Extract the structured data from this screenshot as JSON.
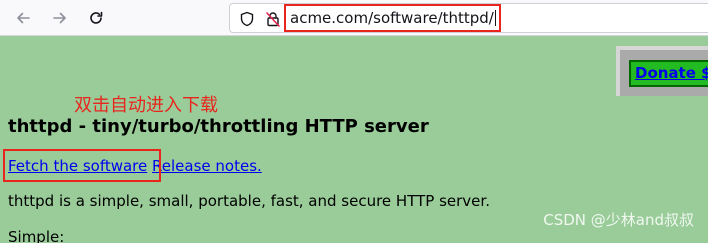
{
  "browser": {
    "url": "acme.com/software/thttpd/",
    "icons": {
      "back": "back-arrow-icon",
      "forward": "forward-arrow-icon",
      "reload": "reload-icon",
      "shield": "tracking-protection-shield-icon",
      "lock": "insecure-lock-icon"
    }
  },
  "page": {
    "donate_label": "Donate $",
    "annotation": "双击自动进入下载",
    "heading": "thttpd - tiny/turbo/throttling HTTP server",
    "fetch_link": "Fetch the software",
    "release_link": "Release notes.",
    "description": "thttpd is a simple, small, portable, fast, and secure HTTP server.",
    "simple_label": "Simple:",
    "watermark": "CSDN @少林and叔叔"
  },
  "colors": {
    "page_bg": "#99cc99",
    "highlight": "#e8261e",
    "link": "#0000ee",
    "donate_bg": "#22bb22"
  }
}
